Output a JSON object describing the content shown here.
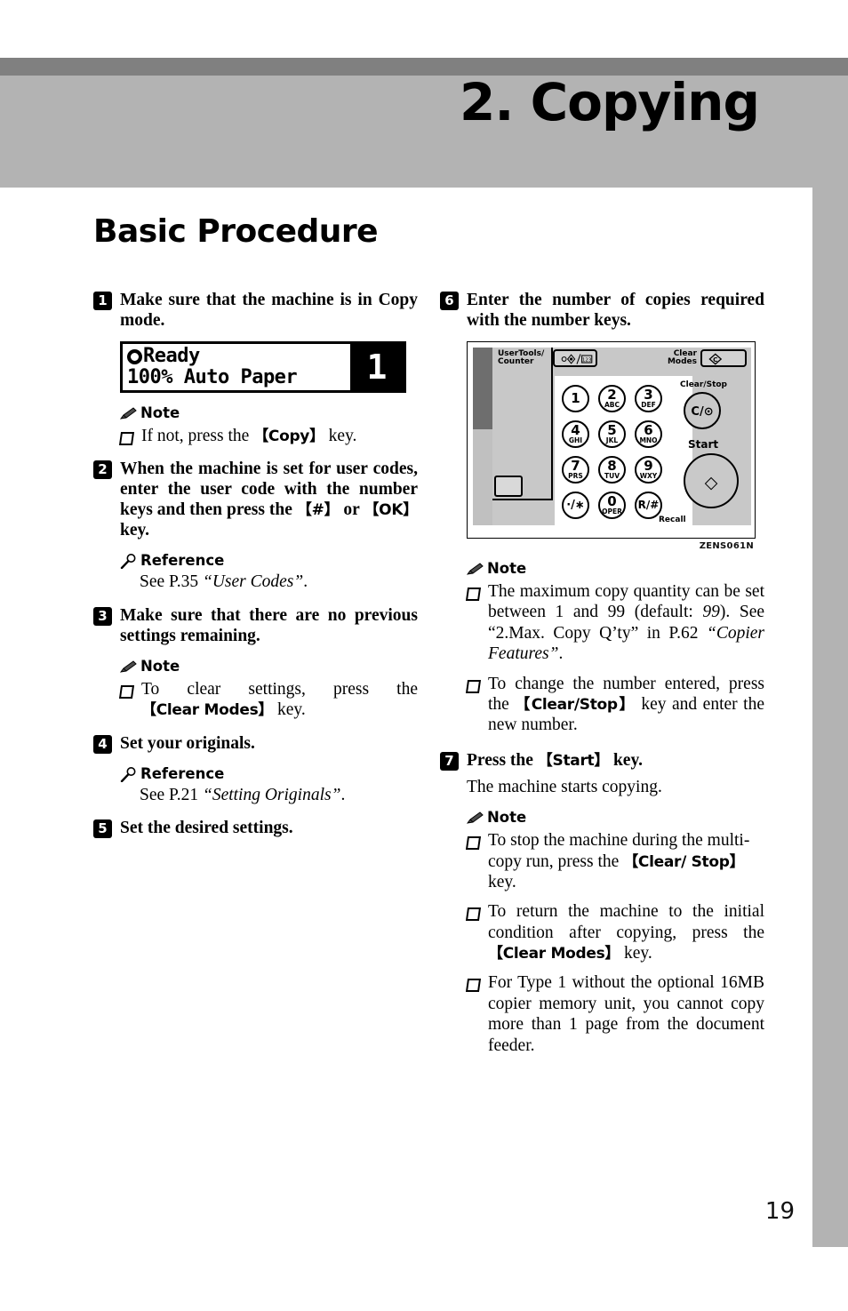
{
  "page": {
    "chapter_title": "2. Copying",
    "section_heading": "Basic Procedure",
    "page_number": "19"
  },
  "left_column": {
    "step1": {
      "number": "1",
      "text": "Make sure that the machine is in Copy mode.",
      "lcd": {
        "line1": "Ready",
        "line2": "100% Auto Paper",
        "count": "1",
        "status_icon": "clock-icon"
      },
      "note": {
        "title": "Note",
        "icon": "pencil-icon",
        "bullets": [
          {
            "pre": "If not, press the ",
            "key": "【Copy】",
            "post": " key."
          }
        ]
      }
    },
    "step2": {
      "number": "2",
      "text_pre": "When the machine is set for user codes, enter the user code with the number keys and then press the ",
      "key1": "【#】",
      "mid": " or ",
      "key2": "【OK】",
      "text_post": " key.",
      "reference": {
        "title": "Reference",
        "icon": "magnifier-icon",
        "text_pre": "See P.35 ",
        "text_italic": "“User Codes”",
        "text_post": "."
      }
    },
    "step3": {
      "number": "3",
      "text": "Make sure that there are no previous settings remaining.",
      "note": {
        "title": "Note",
        "icon": "pencil-icon",
        "bullets": [
          {
            "pre": "To clear settings, press the ",
            "key": "【Clear Modes】",
            "post": " key."
          }
        ]
      }
    },
    "step4": {
      "number": "4",
      "text": "Set your originals.",
      "reference": {
        "title": "Reference",
        "icon": "magnifier-icon",
        "text_pre": "See P.21 ",
        "text_italic": "“Setting Originals”",
        "text_post": "."
      }
    },
    "step5": {
      "number": "5",
      "text": "Set the desired settings."
    }
  },
  "right_column": {
    "step6": {
      "number": "6",
      "text": "Enter the number of copies required with the number keys.",
      "figure": {
        "id_label": "ZENS061N",
        "labels": {
          "user_tools": "UserTools/\nCounter",
          "clear_modes": "Clear\nModes",
          "clear_stop": "Clear/Stop",
          "start": "Start",
          "recall": "Recall"
        },
        "clear_stop_glyph": "C/⊙",
        "start_glyph": "◇",
        "keypad": [
          {
            "digit": "1",
            "letters": ""
          },
          {
            "digit": "2",
            "letters": "ABC"
          },
          {
            "digit": "3",
            "letters": "DEF"
          },
          {
            "digit": "4",
            "letters": "GHI"
          },
          {
            "digit": "5",
            "letters": "JKL"
          },
          {
            "digit": "6",
            "letters": "MNO"
          },
          {
            "digit": "7",
            "letters": "PRS"
          },
          {
            "digit": "8",
            "letters": "TUV"
          },
          {
            "digit": "9",
            "letters": "WXY"
          },
          {
            "digit": "·/∗",
            "letters": ""
          },
          {
            "digit": "0",
            "letters": "OPER"
          },
          {
            "digit": "R/#",
            "letters": ""
          }
        ]
      },
      "note": {
        "title": "Note",
        "icon": "pencil-icon",
        "bullet1": {
          "a": "The maximum copy quantity can be set between 1 and 99 (default: ",
          "b_italic": "99",
          "c": "). See “2.Max. Copy Q’ty” in P.62 ",
          "d_italic": "“Copier Features”",
          "e": "."
        },
        "bullet2": {
          "pre": "To change the number entered, press the ",
          "key": "【Clear/Stop】",
          "post": " key and enter the new number."
        }
      }
    },
    "step7": {
      "number": "7",
      "text_pre": "Press the ",
      "key": "【Start】",
      "text_post": " key.",
      "body": "The machine starts copying.",
      "note": {
        "title": "Note",
        "icon": "pencil-icon",
        "bullet1": {
          "pre": "To stop the machine during the multi-copy run, press the ",
          "key": "【Clear/ Stop】",
          "post": " key."
        },
        "bullet2": {
          "pre": "To return the machine to the initial condition after copying, press the ",
          "key": "【Clear Modes】",
          "post": " key."
        },
        "bullet3": {
          "text": "For Type 1 without the optional 16MB copier memory unit, you cannot copy more than 1 page from the document feeder."
        }
      }
    }
  }
}
